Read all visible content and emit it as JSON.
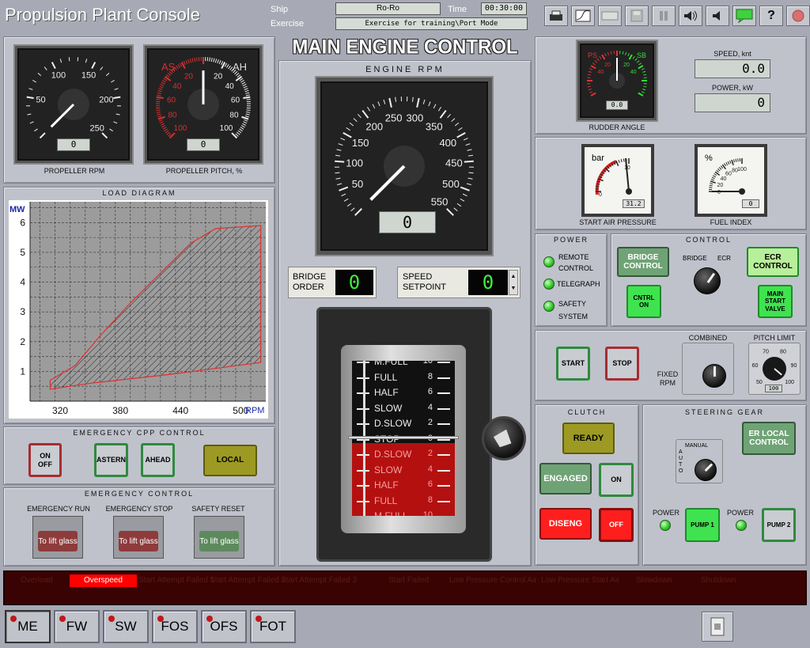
{
  "header": {
    "title": "Propulsion Plant Console",
    "ship_label": "Ship",
    "ship_value": "Ro-Ro",
    "exercise_label": "Exercise",
    "exercise_value": "Exercise for training\\Port Mode",
    "time_label": "Time",
    "time_value": "00:30:00"
  },
  "propeller_rpm": {
    "title": "PROPELLER RPM",
    "value": "0",
    "ticks": [
      "50",
      "100",
      "150",
      "200",
      "250"
    ]
  },
  "propeller_pitch": {
    "title": "PROPELLER PITCH, %",
    "value": "0",
    "as": "AS",
    "ah": "AH",
    "left_ticks": [
      "20",
      "40",
      "60",
      "80",
      "100"
    ],
    "right_ticks": [
      "20",
      "40",
      "60",
      "80",
      "100"
    ]
  },
  "load_diagram": {
    "title": "LOAD DIAGRAM",
    "ylabel": "MW",
    "xlabel": "RPM"
  },
  "chart_data": {
    "type": "area",
    "title": "LOAD DIAGRAM",
    "xlabel": "RPM",
    "ylabel": "MW",
    "xlim": [
      290,
      525
    ],
    "ylim": [
      0,
      6.7
    ],
    "xticks": [
      "320",
      "380",
      "440",
      "500"
    ],
    "yticks": [
      "1",
      "2",
      "3",
      "4",
      "5",
      "6"
    ],
    "grid": true,
    "series": [
      {
        "values": [
          [
            310,
            0.4
          ],
          [
            310,
            0.7
          ],
          [
            335,
            1.2
          ],
          [
            360,
            2.2
          ],
          [
            390,
            3.3
          ],
          [
            420,
            4.3
          ],
          [
            450,
            5.3
          ],
          [
            475,
            5.8
          ],
          [
            520,
            5.9
          ],
          [
            520,
            1.3
          ],
          [
            430,
            0.9
          ],
          [
            350,
            0.6
          ],
          [
            310,
            0.4
          ]
        ]
      }
    ]
  },
  "emergency_cpp": {
    "title": "EMERGENCY CPP CONTROL",
    "on_off": "ON\nOFF",
    "astern": "ASTERN",
    "ahead": "AHEAD",
    "local": "LOCAL"
  },
  "emergency_control": {
    "title": "EMERGENCY CONTROL",
    "run": "EMERGENCY RUN",
    "stop": "EMERGENCY STOP",
    "reset": "SAFETY RESET",
    "glass": "To lift glass"
  },
  "main_engine": {
    "title": "MAIN ENGINE CONTROL",
    "rpm_title": "ENGINE RPM",
    "rpm_value": "0",
    "ticks": [
      "50",
      "100",
      "150",
      "200",
      "250",
      "300",
      "350",
      "400",
      "450",
      "500",
      "550"
    ],
    "bridge_order_label": "BRIDGE ORDER",
    "bridge_order_value": "0",
    "speed_setpoint_label": "SPEED SETPOINT",
    "speed_setpoint_value": "0"
  },
  "telegraph": {
    "ahead": [
      {
        "label": "M.FULL",
        "num": "10"
      },
      {
        "label": "FULL",
        "num": "8"
      },
      {
        "label": "HALF",
        "num": "6"
      },
      {
        "label": "SLOW",
        "num": "4"
      },
      {
        "label": "D.SLOW",
        "num": "2"
      }
    ],
    "stop": "STOP",
    "stop_num": "0",
    "astern": [
      {
        "label": "D.SLOW",
        "num": "2"
      },
      {
        "label": "SLOW",
        "num": "4"
      },
      {
        "label": "HALF",
        "num": "6"
      },
      {
        "label": "FULL",
        "num": "8"
      },
      {
        "label": "M.FULL",
        "num": "10"
      }
    ]
  },
  "rudder": {
    "title": "RUDDER ANGLE",
    "value": "0.0",
    "ps": "PS",
    "sb": "SB",
    "left_ticks": [
      "20",
      "40"
    ],
    "right_ticks": [
      "20",
      "40"
    ]
  },
  "speed": {
    "label": "SPEED, knt",
    "value": "0.0"
  },
  "power": {
    "label": "POWER, kW",
    "value": "0"
  },
  "start_air": {
    "title": "START AIR PRESSURE",
    "unit": "bar",
    "value": "31.2",
    "ticks": [
      "0",
      "10"
    ]
  },
  "fuel_index": {
    "title": "FUEL INDEX",
    "unit": "%",
    "value": "0",
    "ticks": [
      "0",
      "20",
      "40",
      "60",
      "80",
      "100"
    ]
  },
  "power_panel": {
    "title": "POWER",
    "remote": "REMOTE CONTROL",
    "telegraph": "TELEGRAPH",
    "safety": "SAFETY SYSTEM"
  },
  "control_panel": {
    "title": "CONTROL",
    "bridge_control": "BRIDGE CONTROL",
    "ecr_control": "ECR CONTROL",
    "bridge": "BRIDGE",
    "ecr": "ECR",
    "cntrl_on": "CNTRL ON",
    "main_start": "MAIN START VALVE"
  },
  "start_stop": {
    "start": "START",
    "stop": "STOP",
    "combined": "COMBINED",
    "fixed_rpm": "FIXED RPM",
    "pitch_limit": "PITCH LIMIT",
    "pitch_value": "100",
    "pitch_ticks": [
      "50",
      "60",
      "70",
      "80",
      "90",
      "100"
    ]
  },
  "clutch": {
    "title": "CLUTCH",
    "ready": "READY",
    "engaged": "ENGAGED",
    "on": "ON",
    "diseng": "DISENG",
    "off": "OFF"
  },
  "steering": {
    "title": "STEERING GEAR",
    "manual": "MANUAL",
    "auto": "AUTO",
    "er_local": "ER LOCAL CONTROL",
    "power1": "POWER",
    "power2": "POWER",
    "pump1": "PUMP 1",
    "pump2": "PUMP 2"
  },
  "alarms": [
    "Overload",
    "Overspeed",
    "Start Attempt Failed 1",
    "Start Attempt Failed 2",
    "Start Attempt Failed 3",
    "Start Failed",
    "Low Pressure Control Air",
    "Low Pressure Start Air",
    "Slowdown",
    "Shutdown"
  ],
  "tabs": [
    "ME",
    "FW",
    "SW",
    "FOS",
    "OFS",
    "FOT"
  ],
  "colors": {
    "panel": "#bfc2cb",
    "alarm_active": "#ff0000",
    "alarm_bg": "#3a0303",
    "led_green": "#33cc2a"
  }
}
